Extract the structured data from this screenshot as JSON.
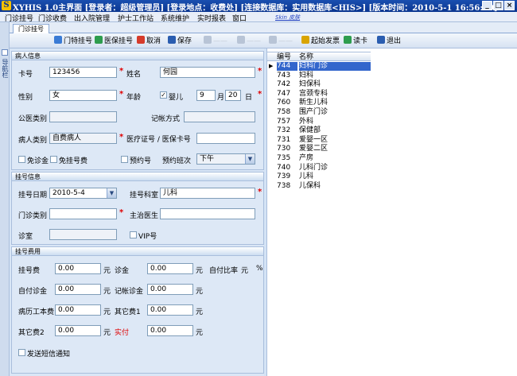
{
  "window": {
    "title": "XYHIS 1.0主界面   [登录者：超级管理员] [登录地点：收费处] [连接数据库：实用数据库<HIS>] [版本时间：2010-5-1 16:56:20]",
    "logo": "S",
    "minimize": "_",
    "maximize": "□",
    "close": "×"
  },
  "menu": {
    "items": [
      "门诊挂号",
      "门诊收费",
      "出入院管理",
      "护士工作站",
      "系统维护",
      "实时报表",
      "窗口"
    ],
    "skin_link": "Skin 皮肤"
  },
  "sidebar": {
    "vertical_text": "导航栏"
  },
  "tabs": {
    "active": "门诊挂号"
  },
  "toolbar": {
    "items": [
      {
        "label": "门特挂号",
        "icon": "people-icon",
        "enabled": true
      },
      {
        "label": "医保挂号",
        "icon": "insurance-icon",
        "enabled": true
      },
      {
        "label": "取消",
        "icon": "cancel-icon",
        "enabled": true
      },
      {
        "label": "保存",
        "icon": "save-icon",
        "enabled": true
      },
      {
        "label": "起始发票",
        "icon": "invoice-icon",
        "enabled": true
      },
      {
        "label": "读卡",
        "icon": "card-reader-icon",
        "enabled": true
      },
      {
        "label": "退出",
        "icon": "exit-icon",
        "enabled": true
      }
    ],
    "accent_colors": {
      "people": "#3a7bd5",
      "insurance": "#2e9d4e",
      "cancel": "#d63b2b",
      "save": "#2a5db0",
      "invoice": "#d9a400",
      "reader": "#2e9d4e",
      "exit": "#2a5db0"
    }
  },
  "patient": {
    "section_title": "病人信息",
    "card_no_label": "卡号",
    "card_no": "123456",
    "name_label": "姓名",
    "name": "何园",
    "gender_label": "性别",
    "gender": "女",
    "age_label": "年龄",
    "infant_label": "婴儿",
    "infant_checked": true,
    "age_years": "9",
    "month_label": "月",
    "age_days": "20",
    "day_label": "日",
    "public_med_label": "公医类别",
    "public_med": "",
    "account_label": "记帐方式",
    "account": "",
    "patient_type_label": "病人类别",
    "patient_type": "自费病人",
    "med_card_label": "医疗证号 / 医保卡号",
    "med_card": "",
    "free_deposit_label": "免诊金",
    "free_reg_fee_label": "免挂号费",
    "appointment_label": "预约号",
    "appt_shift_label": "预约班次",
    "appt_shift": "下午"
  },
  "registration": {
    "section_title": "挂号信息",
    "date_label": "挂号日期",
    "date": "2010-5-4",
    "dept_label": "挂号科室",
    "dept": "儿科",
    "clinic_type_label": "门诊类别",
    "clinic_type": "",
    "doctor_label": "主治医生",
    "doctor": "",
    "room_label": "诊室",
    "room": "",
    "vip_label": "VIP号"
  },
  "fees": {
    "section_title": "挂号费用",
    "reg_fee_label": "挂号费",
    "reg_fee": "0.00",
    "deposit_label": "诊金",
    "deposit": "0.00",
    "self_ratio_label": "自付比率",
    "pct": "%",
    "self_deposit_label": "自付诊金",
    "self_deposit": "0.00",
    "account_deposit_label": "记帐诊金",
    "account_deposit": "0.00",
    "record_fee_label": "病历工本费",
    "record_fee": "0.00",
    "other1_label": "其它费1",
    "other1": "0.00",
    "other2_label": "其它费2",
    "other2": "0.00",
    "paid_label": "实付",
    "paid": "0.00",
    "currency": "元",
    "sms_label": "发送短信通知"
  },
  "dept_list": {
    "col_code": "编号",
    "col_name": "名称",
    "rows": [
      {
        "code": "744",
        "name": "妇科门诊",
        "selected": true
      },
      {
        "code": "743",
        "name": "妇科"
      },
      {
        "code": "742",
        "name": "妇保科"
      },
      {
        "code": "747",
        "name": "宫颈专科"
      },
      {
        "code": "760",
        "name": "新生儿科"
      },
      {
        "code": "758",
        "name": "围产门诊"
      },
      {
        "code": "757",
        "name": "外科"
      },
      {
        "code": "732",
        "name": "保健部"
      },
      {
        "code": "731",
        "name": "爱婴一区"
      },
      {
        "code": "730",
        "name": "爱婴二区"
      },
      {
        "code": "735",
        "name": "产房"
      },
      {
        "code": "740",
        "name": "儿科门诊"
      },
      {
        "code": "739",
        "name": "儿科"
      },
      {
        "code": "738",
        "name": "儿保科"
      }
    ]
  }
}
